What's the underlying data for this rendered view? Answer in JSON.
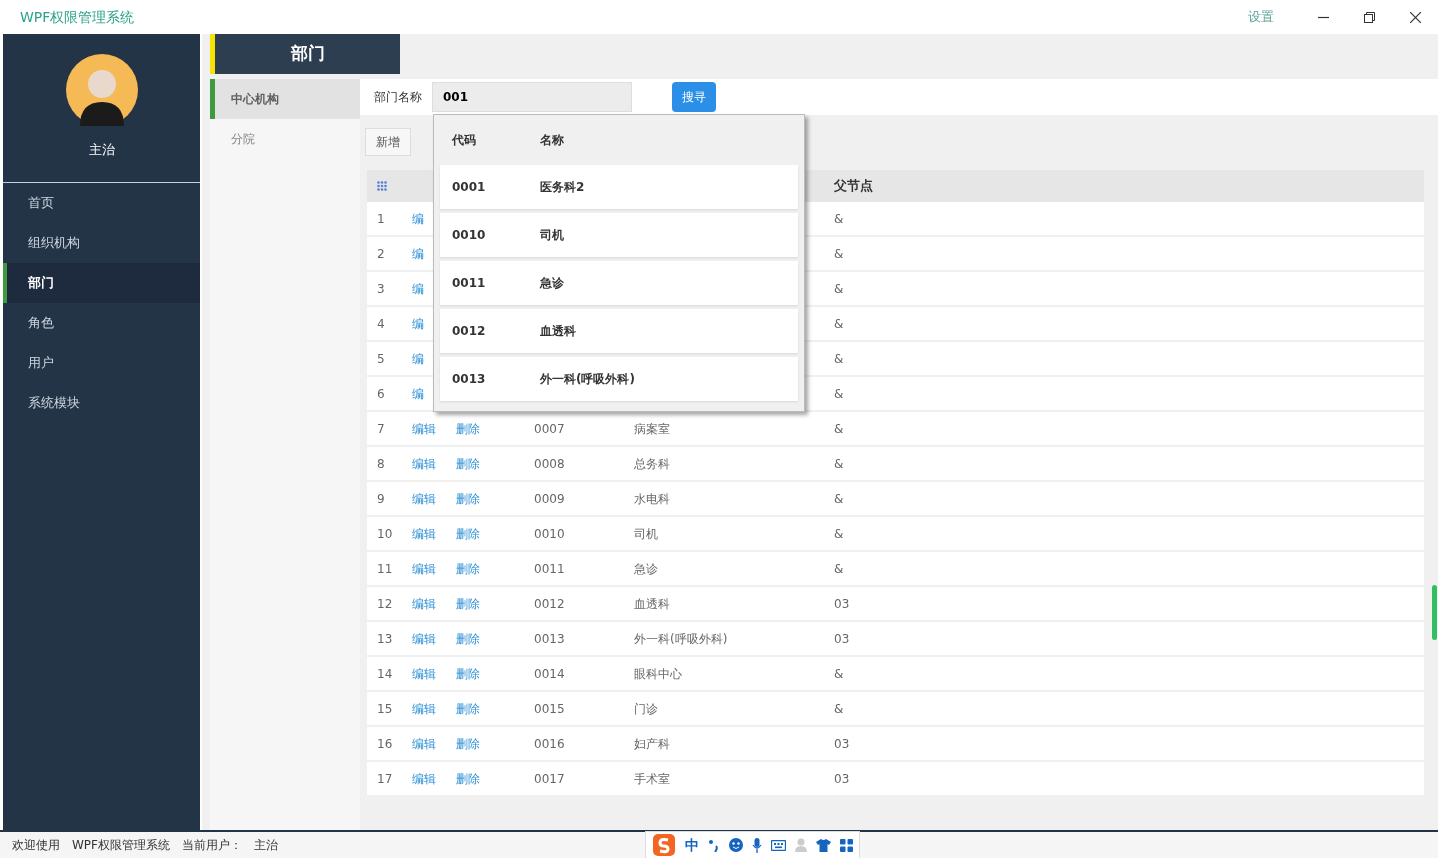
{
  "window": {
    "title": "WPF权限管理系统",
    "settings": "设置"
  },
  "sidebar": {
    "user": "主治",
    "items": [
      {
        "label": "首页",
        "selected": false
      },
      {
        "label": "组织机构",
        "selected": false
      },
      {
        "label": "部门",
        "selected": true
      },
      {
        "label": "角色",
        "selected": false
      },
      {
        "label": "用户",
        "selected": false
      },
      {
        "label": "系统模块",
        "selected": false
      }
    ]
  },
  "page_tab": "部门",
  "org_list": [
    {
      "label": "中心机构",
      "selected": true
    },
    {
      "label": "分院",
      "selected": false
    }
  ],
  "search": {
    "label": "部门名称",
    "value": "001",
    "button": "搜寻"
  },
  "add_button": "新增",
  "table": {
    "parent_header": "父节点",
    "rows": [
      {
        "index": "1",
        "edit": "编",
        "parent": "&"
      },
      {
        "index": "2",
        "edit": "编",
        "parent": "&"
      },
      {
        "index": "3",
        "edit": "编",
        "parent": "&"
      },
      {
        "index": "4",
        "edit": "编",
        "parent": "&"
      },
      {
        "index": "5",
        "edit": "编",
        "parent": "&"
      },
      {
        "index": "6",
        "edit": "编",
        "parent": "&"
      },
      {
        "index": "7",
        "edit": "编辑",
        "delete": "删除",
        "code": "0007",
        "name": "病案室",
        "parent": "&"
      },
      {
        "index": "8",
        "edit": "编辑",
        "delete": "删除",
        "code": "0008",
        "name": "总务科",
        "parent": "&"
      },
      {
        "index": "9",
        "edit": "编辑",
        "delete": "删除",
        "code": "0009",
        "name": "水电科",
        "parent": "&"
      },
      {
        "index": "10",
        "edit": "编辑",
        "delete": "删除",
        "code": "0010",
        "name": "司机",
        "parent": "&"
      },
      {
        "index": "11",
        "edit": "编辑",
        "delete": "删除",
        "code": "0011",
        "name": "急诊",
        "parent": "&"
      },
      {
        "index": "12",
        "edit": "编辑",
        "delete": "删除",
        "code": "0012",
        "name": "血透科",
        "parent": "03"
      },
      {
        "index": "13",
        "edit": "编辑",
        "delete": "删除",
        "code": "0013",
        "name": "外一科(呼吸外科)",
        "parent": "03"
      },
      {
        "index": "14",
        "edit": "编辑",
        "delete": "删除",
        "code": "0014",
        "name": "眼科中心",
        "parent": "&"
      },
      {
        "index": "15",
        "edit": "编辑",
        "delete": "删除",
        "code": "0015",
        "name": "门诊",
        "parent": "&"
      },
      {
        "index": "16",
        "edit": "编辑",
        "delete": "删除",
        "code": "0016",
        "name": "妇产科",
        "parent": "03"
      },
      {
        "index": "17",
        "edit": "编辑",
        "delete": "删除",
        "code": "0017",
        "name": "手术室",
        "parent": "03"
      }
    ]
  },
  "dropdown": {
    "columns": [
      "代码",
      "名称"
    ],
    "rows": [
      {
        "code": "0001",
        "name": "医务科2"
      },
      {
        "code": "0010",
        "name": "司机"
      },
      {
        "code": "0011",
        "name": "急诊"
      },
      {
        "code": "0012",
        "name": "血透科"
      },
      {
        "code": "0013",
        "name": "外一科(呼吸外科)"
      }
    ]
  },
  "status_bar": [
    "欢迎使用",
    "WPF权限管理系统",
    "当前用户：",
    "主治"
  ],
  "ime_bar": {
    "mode": "中"
  }
}
